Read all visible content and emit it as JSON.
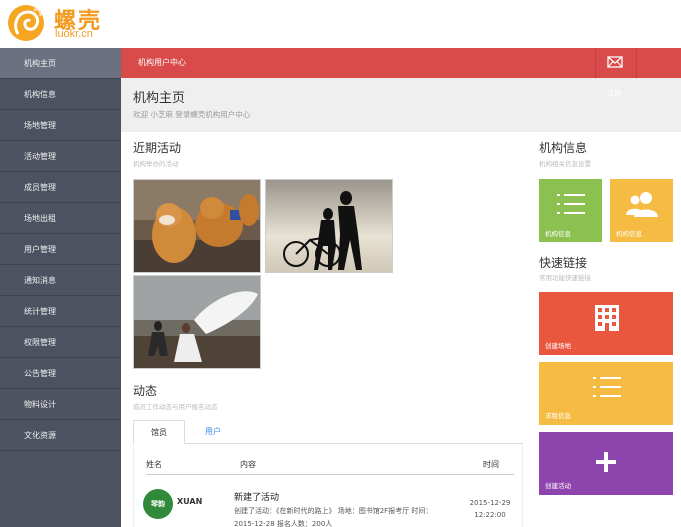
{
  "logo": {
    "cn": "螺壳",
    "en": "luokr.cn"
  },
  "sidebar": {
    "items": [
      {
        "label": "机构主页"
      },
      {
        "label": "机构信息"
      },
      {
        "label": "场地管理"
      },
      {
        "label": "活动管理"
      },
      {
        "label": "成员管理"
      },
      {
        "label": "场地出租"
      },
      {
        "label": "用户管理"
      },
      {
        "label": "通知消息"
      },
      {
        "label": "统计管理"
      },
      {
        "label": "权限管理"
      },
      {
        "label": "公告管理"
      },
      {
        "label": "物料设计"
      },
      {
        "label": "文化资源"
      }
    ]
  },
  "topbar": {
    "title": "机构用户中心",
    "mail_icon": "envelope-icon"
  },
  "header": {
    "title": "机构主页",
    "welcome": "欢迎 小芝麻 登录螺壳机构用户中心",
    "faint_button": "注销"
  },
  "recent": {
    "title": "近期活动",
    "subtitle": "机构举办的活动",
    "photos": [
      "dogs-photo",
      "cyclists-silhouette-photo",
      "wedding-photo"
    ]
  },
  "feed": {
    "title": "动态",
    "subtitle": "成员工作动态与用户报名动态",
    "tabs": {
      "staff": "馆员",
      "user": "用户"
    },
    "columns": {
      "name": "姓名",
      "content": "内容",
      "time": "时间"
    },
    "rows": [
      {
        "avatar_text": "琴韵",
        "name": "XUAN",
        "title": "新建了活动",
        "desc": "创建了活动：《在新时代的路上》 场地：图书馆2F报考厅 时间：2015-12-28 报名人数：200人",
        "date": "2015-12-29",
        "time": "12:22:00"
      }
    ]
  },
  "org": {
    "title": "机构信息",
    "subtitle": "机构相关信息设置",
    "tiles": [
      {
        "label": "机构信息",
        "color": "#8cc152",
        "icon": "list-icon"
      },
      {
        "label": "机构信息",
        "color": "#f6bb42",
        "icon": "users-icon"
      }
    ]
  },
  "quick": {
    "title": "快速链接",
    "subtitle": "常用功能快速链接",
    "tiles": [
      {
        "label": "创建场地",
        "color": "#e9573f",
        "icon": "building-icon"
      },
      {
        "label": "求租信息",
        "color": "#f6bb42",
        "icon": "list-icon"
      },
      {
        "label": "创建活动",
        "color": "#8e44ad",
        "icon": "plus-icon"
      }
    ]
  }
}
